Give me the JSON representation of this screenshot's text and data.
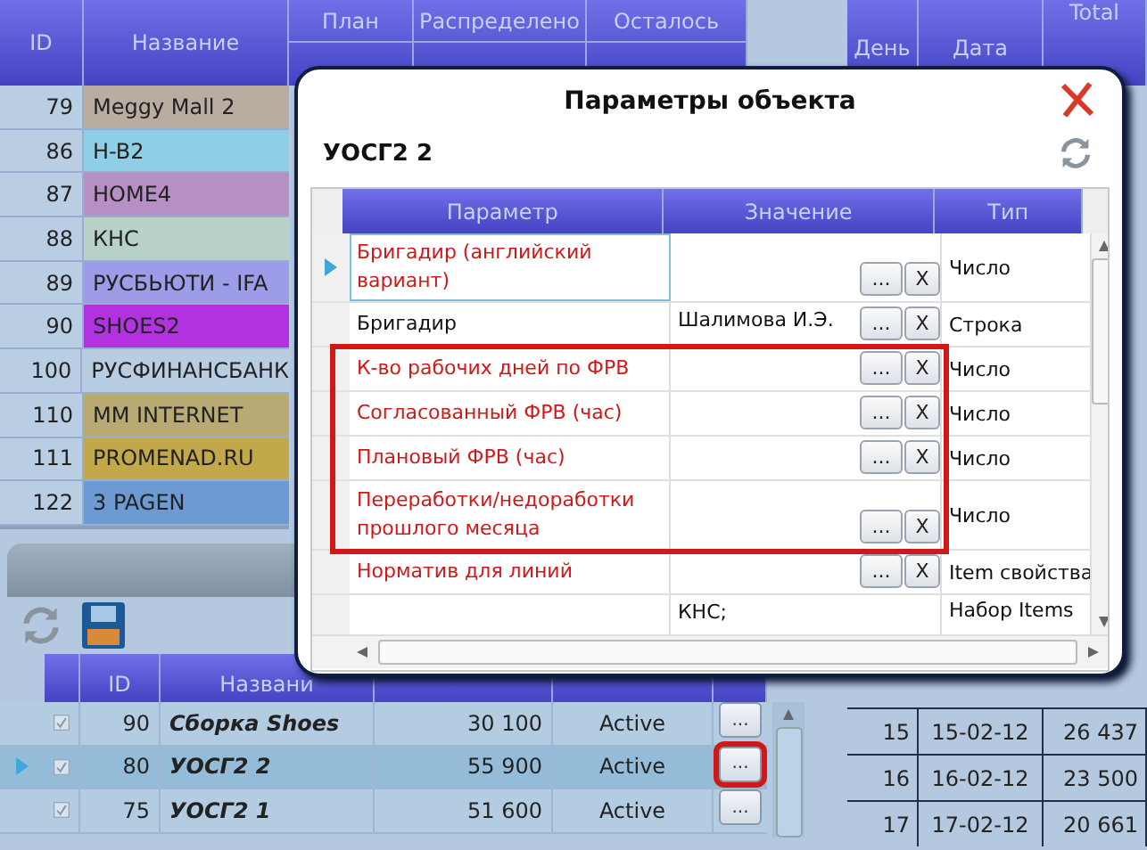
{
  "objects_table": {
    "columns": [
      "ID",
      "Название"
    ],
    "rows": [
      {
        "id": "79",
        "name": "Meggy Mall 2",
        "color": "#b8ada0"
      },
      {
        "id": "86",
        "name": "H-B2",
        "color": "#8fcfe6"
      },
      {
        "id": "87",
        "name": "HOME4",
        "color": "#b690c4"
      },
      {
        "id": "88",
        "name": "КНС",
        "color": "#b9d2c8"
      },
      {
        "id": "89",
        "name": "РУСБЬЮТИ - IFA",
        "color": "#9c9ce8"
      },
      {
        "id": "90",
        "name": "SHOES2",
        "color": "#b232e0"
      },
      {
        "id": "100",
        "name": "РУСФИНАНСБАНК",
        "color": "#b9cde2"
      },
      {
        "id": "110",
        "name": "MM INTERNET",
        "color": "#b9a972"
      },
      {
        "id": "111",
        "name": "PROMENAD.RU",
        "color": "#c2a84a"
      },
      {
        "id": "122",
        "name": "3 PAGEN",
        "color": "#6d9ad2"
      }
    ]
  },
  "plan_header": {
    "columns": [
      "План",
      "Распределено",
      "Осталось"
    ]
  },
  "day_table": {
    "columns": [
      "День",
      "Дата",
      "Total"
    ],
    "rows": [
      {
        "day": "15",
        "date": "15-02-12",
        "total": "26 437"
      },
      {
        "day": "16",
        "date": "16-02-12",
        "total": "23 500"
      },
      {
        "day": "17",
        "date": "17-02-12",
        "total": "20 661"
      }
    ]
  },
  "items_table": {
    "columns": [
      "ID",
      "Названи"
    ],
    "rows": [
      {
        "checked": true,
        "id": "90",
        "name": "Сборка Shoes",
        "amount": "30 100",
        "status": "Active",
        "button": "...",
        "selected": false,
        "annotated": false
      },
      {
        "checked": true,
        "id": "80",
        "name": "УОСГ2 2",
        "amount": "55 900",
        "status": "Active",
        "button": "...",
        "selected": true,
        "annotated": true
      },
      {
        "checked": true,
        "id": "75",
        "name": "УОСГ2 1",
        "amount": "51 600",
        "status": "Active",
        "button": "...",
        "selected": false,
        "annotated": false
      }
    ]
  },
  "dialog": {
    "title": "Параметры объекта",
    "object": "УОСГ2 2",
    "grid": {
      "columns": [
        "Параметр",
        "Значение",
        "Тип"
      ],
      "rows": [
        {
          "parameter": "Бригадир (английский вариант)",
          "type": "Число",
          "edit_button": "...",
          "clear_button": "X",
          "required": true,
          "selected": true,
          "annotated": false
        },
        {
          "parameter": "Бригадир",
          "value": "Шалимова И.Э.",
          "type": "Строка",
          "edit_button": "...",
          "clear_button": "X",
          "required": false,
          "selected": false,
          "annotated": false
        },
        {
          "parameter": "К-во рабочих дней по ФРВ",
          "type": "Число",
          "edit_button": "...",
          "clear_button": "X",
          "required": true,
          "selected": false,
          "annotated": true
        },
        {
          "parameter": "Согласованный ФРВ (час)",
          "type": "Число",
          "edit_button": "...",
          "clear_button": "X",
          "required": true,
          "selected": false,
          "annotated": true
        },
        {
          "parameter": "Плановый ФРВ (час)",
          "type": "Число",
          "edit_button": "...",
          "clear_button": "X",
          "required": true,
          "selected": false,
          "annotated": true
        },
        {
          "parameter": "Переработки/недоработки прошлого месяца",
          "type": "Число",
          "edit_button": "...",
          "clear_button": "X",
          "required": true,
          "selected": false,
          "annotated": true
        },
        {
          "parameter": "Норматив для линий",
          "type": "Item свойства",
          "edit_button": "...",
          "clear_button": "X",
          "required": true,
          "selected": false,
          "annotated": false
        },
        {
          "value": "КНС;",
          "type": "Набор Items",
          "selected": false,
          "annotated": false
        }
      ]
    }
  }
}
